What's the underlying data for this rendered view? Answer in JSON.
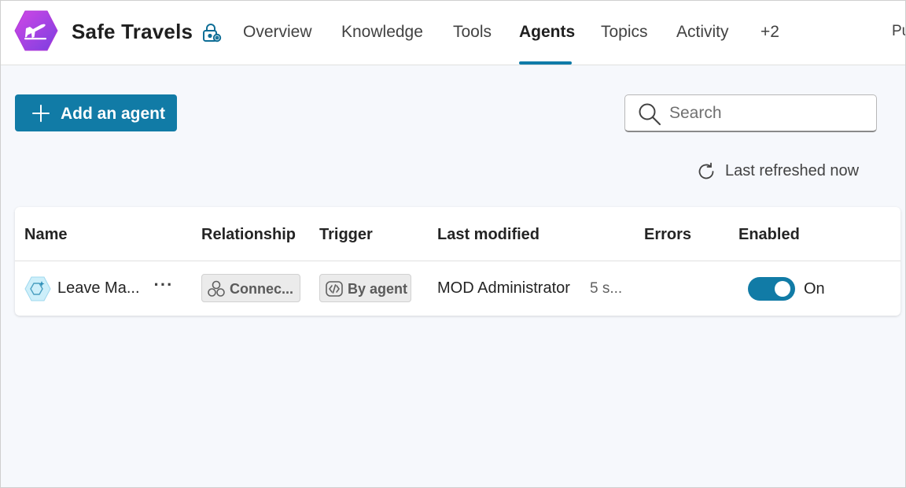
{
  "app": {
    "title": "Safe Travels",
    "logo_icon": "airplane-icon",
    "settings_icon": "lock-settings-icon"
  },
  "nav": {
    "tabs": [
      {
        "label": "Overview"
      },
      {
        "label": "Knowledge"
      },
      {
        "label": "Tools"
      },
      {
        "label": "Agents",
        "active": true
      },
      {
        "label": "Topics"
      },
      {
        "label": "Activity"
      },
      {
        "label": "+2"
      }
    ],
    "publish_stub": "Pu"
  },
  "toolbar": {
    "add_label": "Add an agent",
    "search_placeholder": "Search",
    "refresh_text": "Last refreshed now"
  },
  "table": {
    "columns": [
      "Name",
      "Relationship",
      "Trigger",
      "Last modified",
      "Errors",
      "Enabled"
    ],
    "rows": [
      {
        "name": "Leave Ma...",
        "more": "···",
        "relationship": "Connec...",
        "trigger": "By agent",
        "modified_by": "MOD Administrator",
        "modified_time": "5 s...",
        "errors": "",
        "enabled": true,
        "enabled_label": "On"
      }
    ]
  },
  "colors": {
    "accent": "#117ba6",
    "logo_gradient_start": "#c13ee6",
    "logo_gradient_end": "#7b3fe4"
  }
}
